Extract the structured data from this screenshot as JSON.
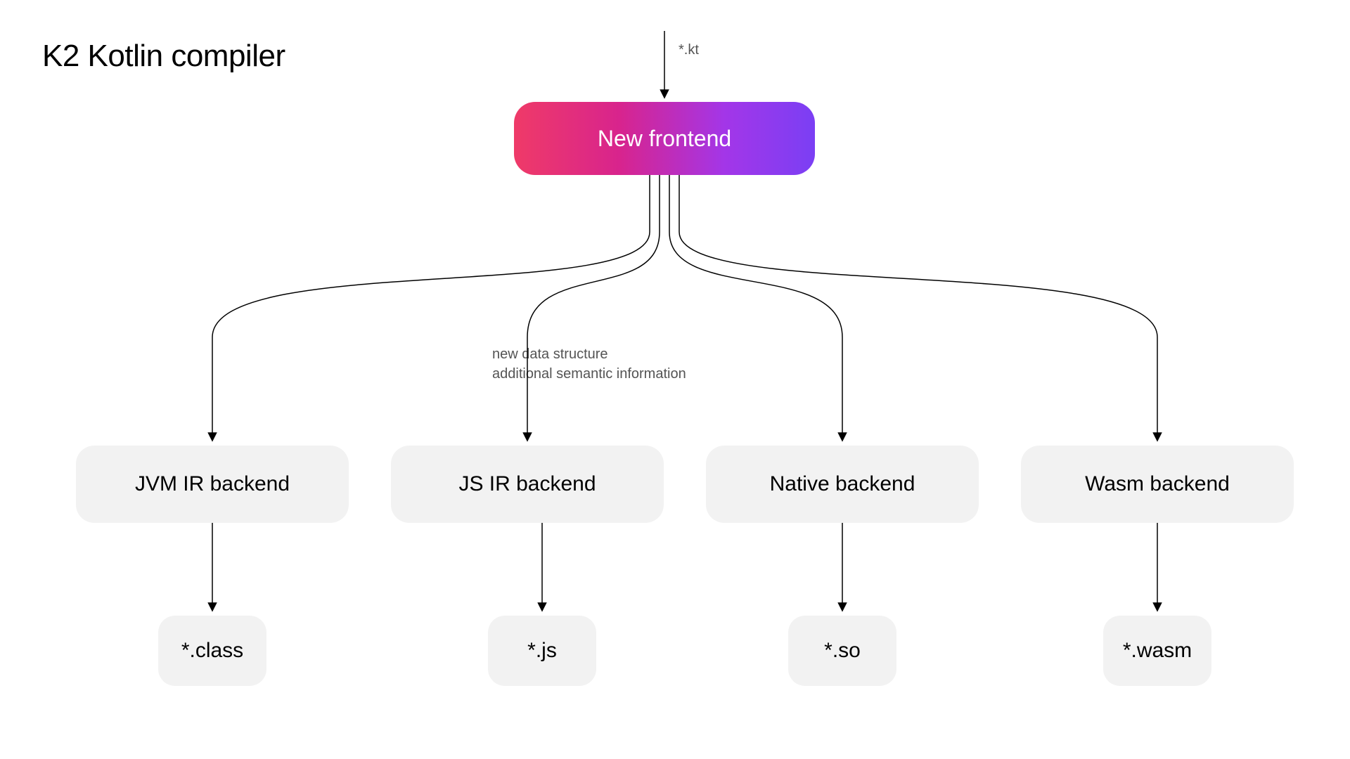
{
  "title": "K2 Kotlin compiler",
  "input_label": "*.kt",
  "frontend_label": "New frontend",
  "mid_label_line1": "new data structure",
  "mid_label_line2": "additional semantic information",
  "backends": [
    {
      "label": "JVM IR backend",
      "output": "*.class"
    },
    {
      "label": "JS IR backend",
      "output": "*.js"
    },
    {
      "label": "Native backend",
      "output": "*.so"
    },
    {
      "label": "Wasm backend",
      "output": "*.wasm"
    }
  ],
  "colors": {
    "box_bg": "#f2f2f2",
    "gradient_from": "#ef3a68",
    "gradient_to": "#7b3ff4",
    "label": "#545454"
  },
  "chart_data": {
    "type": "table",
    "title": "K2 Kotlin compiler",
    "nodes": [
      {
        "id": "input",
        "label": "*.kt",
        "kind": "input"
      },
      {
        "id": "frontend",
        "label": "New frontend",
        "kind": "frontend"
      },
      {
        "id": "jvm",
        "label": "JVM IR backend",
        "kind": "backend"
      },
      {
        "id": "js",
        "label": "JS IR backend",
        "kind": "backend"
      },
      {
        "id": "native",
        "label": "Native backend",
        "kind": "backend"
      },
      {
        "id": "wasm",
        "label": "Wasm backend",
        "kind": "backend"
      },
      {
        "id": "out_jvm",
        "label": "*.class",
        "kind": "output"
      },
      {
        "id": "out_js",
        "label": "*.js",
        "kind": "output"
      },
      {
        "id": "out_native",
        "label": "*.so",
        "kind": "output"
      },
      {
        "id": "out_wasm",
        "label": "*.wasm",
        "kind": "output"
      }
    ],
    "edges": [
      {
        "from": "input",
        "to": "frontend"
      },
      {
        "from": "frontend",
        "to": "jvm",
        "note": "new data structure, additional semantic information"
      },
      {
        "from": "frontend",
        "to": "js",
        "note": "new data structure, additional semantic information"
      },
      {
        "from": "frontend",
        "to": "native",
        "note": "new data structure, additional semantic information"
      },
      {
        "from": "frontend",
        "to": "wasm",
        "note": "new data structure, additional semantic information"
      },
      {
        "from": "jvm",
        "to": "out_jvm"
      },
      {
        "from": "js",
        "to": "out_js"
      },
      {
        "from": "native",
        "to": "out_native"
      },
      {
        "from": "wasm",
        "to": "out_wasm"
      }
    ]
  }
}
